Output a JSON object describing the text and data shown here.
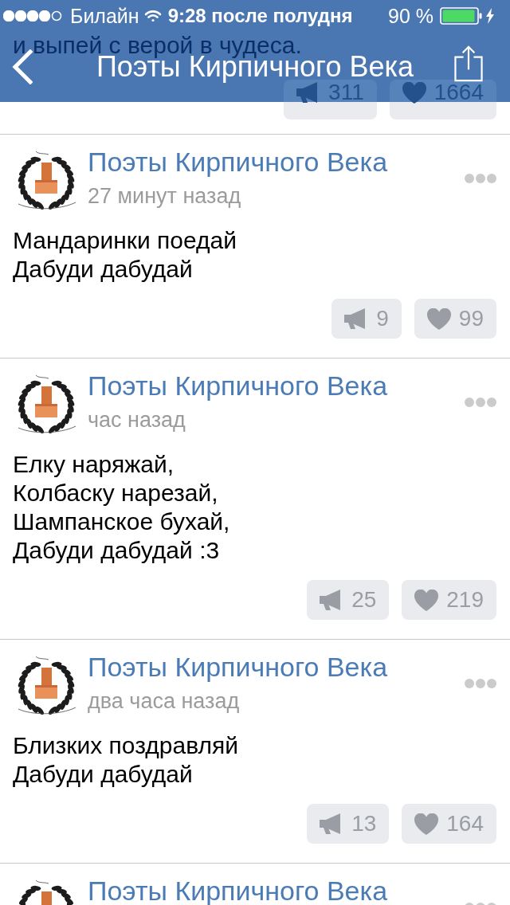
{
  "status_bar": {
    "carrier": "Билайн",
    "time": "9:28 после полудня",
    "battery": "90 %"
  },
  "nav_bar": {
    "title": "Поэты Кирпичного Века"
  },
  "previous_post": {
    "text": "и выпей с верой в чудеса.",
    "reposts": "311",
    "likes": "1664"
  },
  "posts": [
    {
      "author": "Поэты Кирпичного Века",
      "time": "27 минут назад",
      "text": "Мандаринки поедай\nДабуди дабудай",
      "reposts": "9",
      "likes": "99"
    },
    {
      "author": "Поэты Кирпичного Века",
      "time": "час назад",
      "text": "Елку наряжай,\nКолбаску нарезай,\nШампанское бухай,\nДабуди дабудай :3",
      "reposts": "25",
      "likes": "219"
    },
    {
      "author": "Поэты Кирпичного Века",
      "time": "два часа назад",
      "text": "Близких поздравляй\nДабуди дабудай",
      "reposts": "13",
      "likes": "164"
    },
    {
      "author": "Поэты Кирпичного Века"
    }
  ]
}
